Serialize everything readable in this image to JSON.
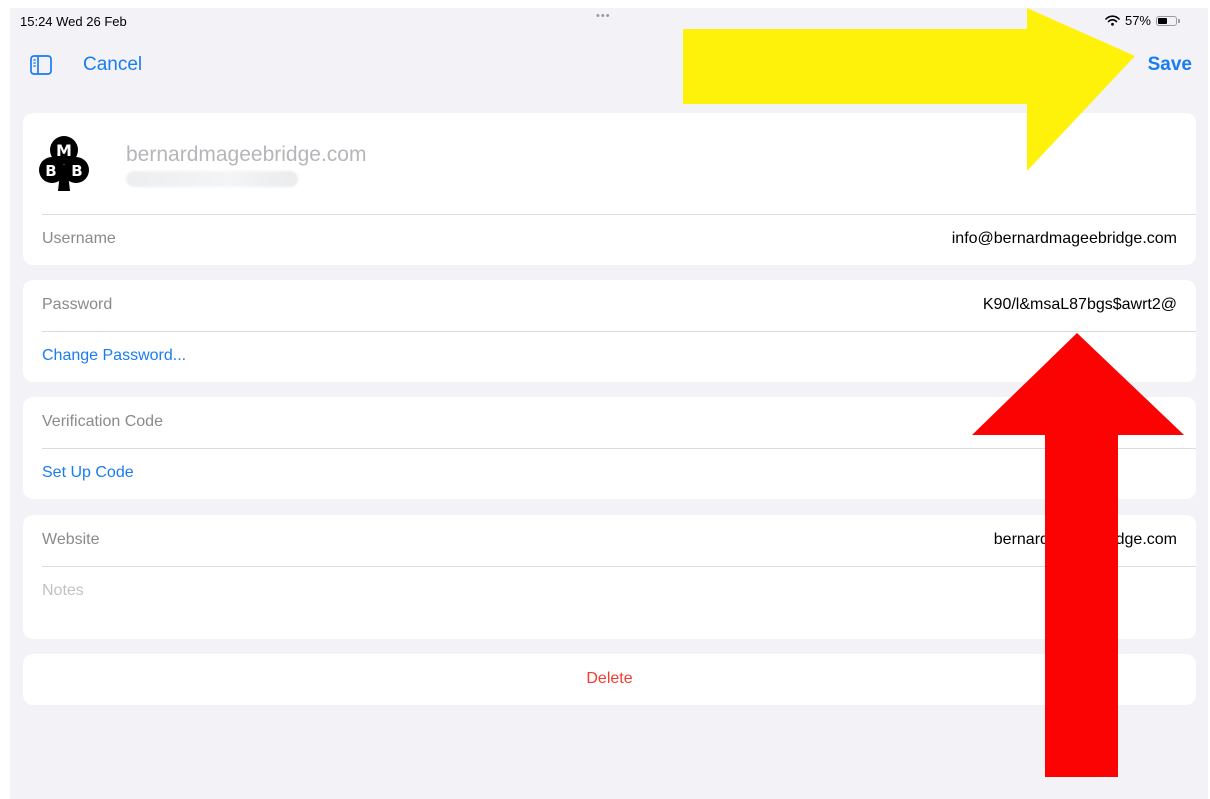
{
  "status_bar": {
    "time": "15:24  Wed 26 Feb",
    "dots": "•••",
    "battery_percent": "57%",
    "battery_level": 0.57
  },
  "nav": {
    "cancel_label": "Cancel",
    "save_label": "Save"
  },
  "header": {
    "site": "bernardmageebridge.com",
    "logo_letters": [
      "M",
      "B",
      "B"
    ]
  },
  "fields": {
    "username_label": "Username",
    "username_value": "info@bernardmageebridge.com",
    "password_label": "Password",
    "password_value": "K90/l&msaL87bgs$awrt2@",
    "change_password_label": "Change Password...",
    "verification_label": "Verification Code",
    "setup_code_label": "Set Up Code",
    "website_label": "Website",
    "website_value": "bernardmageebridge.com",
    "notes_placeholder": "Notes"
  },
  "actions": {
    "delete_label": "Delete"
  },
  "colors": {
    "accent": "#1a7cf3",
    "destructive": "#f53b2f",
    "arrow_yellow": "#fff20a",
    "arrow_red": "#fb0303"
  }
}
